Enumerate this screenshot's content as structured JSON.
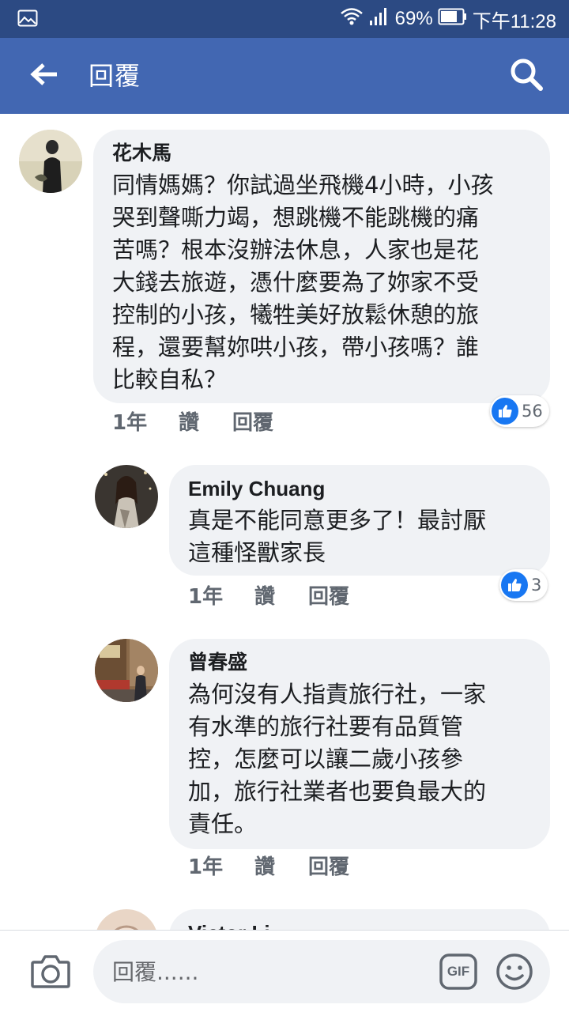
{
  "status_bar": {
    "battery_percent": "69%",
    "time": "下午11:28",
    "icons": [
      "image-icon",
      "wifi-icon",
      "signal-icon",
      "battery-icon"
    ]
  },
  "app_bar": {
    "title": "回覆",
    "back_icon": "arrow-left-icon",
    "search_icon": "search-icon"
  },
  "comments": [
    {
      "author": "花木馬",
      "text": [
        "同情媽媽？你試過坐飛機4小時，小孩",
        "哭到聲嘶力竭，想跳機不能跳機的痛",
        "苦嗎？根本沒辦法休息，人家也是花",
        "大錢去旅遊，憑什麼要為了妳家不受",
        "控制的小孩，犧牲美好放鬆休憩的旅",
        "程，還要幫妳哄小孩，帶小孩嗎？誰",
        "比較自私？"
      ],
      "time": "1年",
      "like_label": "讚",
      "reply_label": "回覆",
      "reaction_count": "56"
    },
    {
      "author": "Emily Chuang",
      "text": [
        "真是不能同意更多了！最討厭",
        "這種怪獸家長"
      ],
      "time": "1年",
      "like_label": "讚",
      "reply_label": "回覆",
      "reaction_count": "3"
    },
    {
      "author": "曾春盛",
      "text": [
        "為何沒有人指責旅行社，一家",
        "有水準的旅行社要有品質管",
        "控，怎麼可以讓二歲小孩參",
        "加，旅行社業者也要負最大的",
        "責任。"
      ],
      "time": "1年",
      "like_label": "讚",
      "reply_label": "回覆"
    },
    {
      "author": "Victor Li"
    }
  ],
  "composer": {
    "placeholder": "回覆......",
    "gif_label": "GIF",
    "camera_icon": "camera-icon",
    "emoji_icon": "emoji-icon"
  },
  "colors": {
    "status_bar": "#2c4a83",
    "app_bar": "#4267b2",
    "bubble": "#f0f2f5",
    "like_blue": "#1877f2",
    "meta_text": "#606770"
  }
}
